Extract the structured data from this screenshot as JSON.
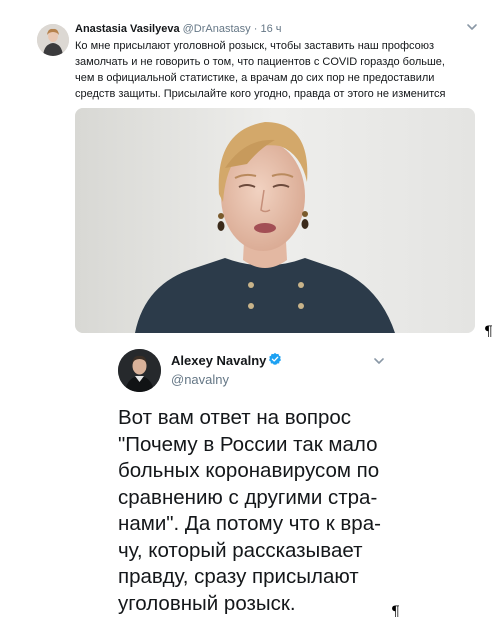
{
  "tweet1": {
    "author_name": "Anastasia Vasilyeva",
    "handle": "@DrAnastasy",
    "separator": "·",
    "time": "16 ч",
    "text_lines": [
      "Ко мне присылают уголовной розыск, чтобы заставить наш профсоюз",
      "замолчать и не говорить о том, что пациентов с COVID гораздо больше,",
      "чем в официальной статистике, а врачам до сих пор не предоставили",
      "средств защиты. Присылайте кого угодно, правда от этого не изменится"
    ],
    "avatar_icon": "person-photo",
    "menu_icon": "chevron-down-icon",
    "media": "video-frame-woman-speaking"
  },
  "tweet2": {
    "author_name": "Alexey Navalny",
    "handle": "@navalny",
    "verified_icon": "verified-badge-icon",
    "menu_icon": "chevron-down-icon",
    "text_lines": [
      "Вот вам ответ на вопрос",
      "\"Почему в России так мало",
      "больных коронавирусом по",
      "сравнению с другими стра-",
      "нами\". Да потому что к вра-",
      "чу, который рассказывает",
      "правду, сразу присылают",
      "уголовный розыск."
    ]
  },
  "pilcrow_1": "¶",
  "pilcrow_2": "¶",
  "colors": {
    "text": "#14171a",
    "secondary": "#657786",
    "verified": "#1da1f2"
  }
}
